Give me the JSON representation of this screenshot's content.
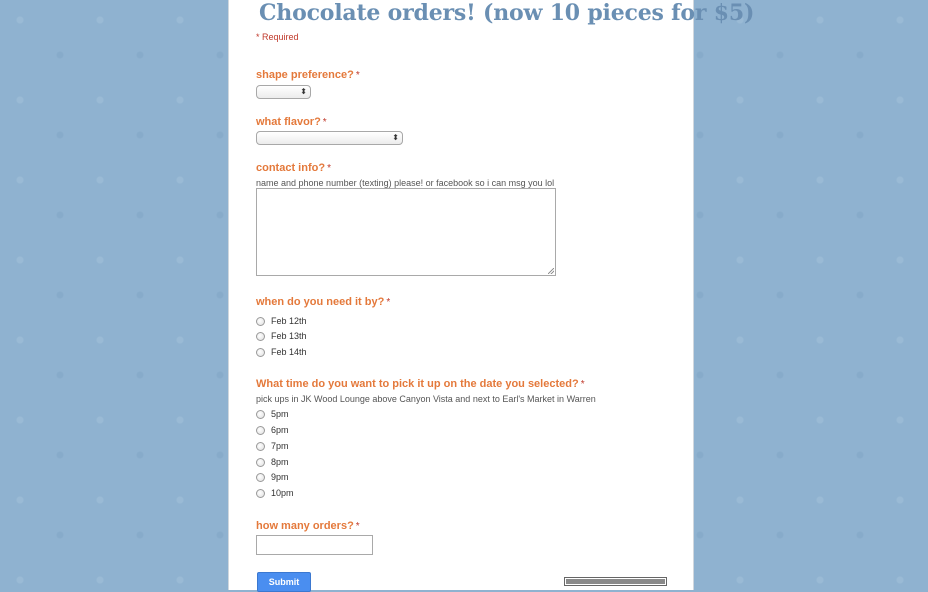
{
  "form": {
    "title": "Chocolate orders! (now 10 pieces for $5)",
    "required_note": "* Required",
    "required_marker": "*",
    "questions": {
      "shape": {
        "label": "shape preference?",
        "selected": ""
      },
      "flavor": {
        "label": "what flavor?",
        "selected": ""
      },
      "contact": {
        "label": "contact info?",
        "help": "name and phone number (texting) please! or facebook so i can msg you lol",
        "value": ""
      },
      "date": {
        "label": "when do you need it by?",
        "options": [
          "Feb 12th",
          "Feb 13th",
          "Feb 14th"
        ]
      },
      "time": {
        "label": "What time do you want to pick it up on the date you selected?",
        "help": "pick ups in JK Wood Lounge above Canyon Vista and next to Earl's Market in Warren",
        "options": [
          "5pm",
          "6pm",
          "7pm",
          "8pm",
          "9pm",
          "10pm"
        ]
      },
      "quantity": {
        "label": "how many orders?",
        "value": ""
      }
    },
    "submit_label": "Submit",
    "progress_fraction": 1.0
  },
  "colors": {
    "background": "#8fb2d0",
    "title": "#6a8fb3",
    "question_label": "#e4793b",
    "required": "#c0392b",
    "submit": "#4a8ef0"
  }
}
